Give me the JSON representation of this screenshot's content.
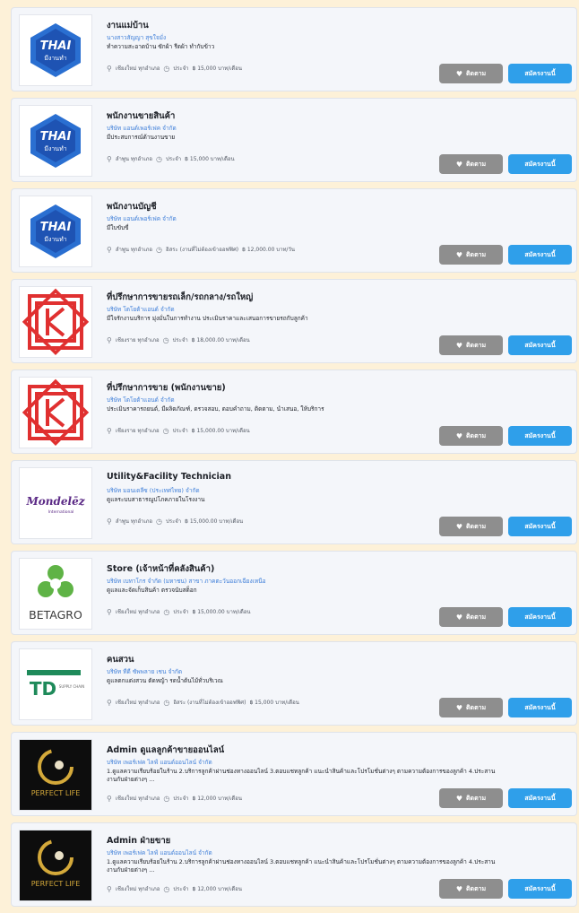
{
  "colors": {
    "apply": "#2f9fea",
    "save": "#8e8e8e",
    "company_link": "#3f7fd9",
    "background": "#fdf1d8"
  },
  "jobs": [
    {
      "logo": "thai-jobs-logo",
      "logo_text_1": "THAI",
      "logo_text_2": "มีงานทำ",
      "title": "งานแม่บ้าน",
      "company": "นางสาวสัญญา สุขใจมั่ง",
      "desc": "ทำความสะอาดบ้าน ซักผ้า รีดผ้า ทำกับข้าว",
      "location": "เชียงใหม่ ทุกอำเภอ",
      "type": "ประจำ",
      "salary": "฿ 15,000 บาท/เดือน",
      "save": "ติดตาม",
      "apply": "สมัครงานนี้"
    },
    {
      "logo": "thai-jobs-logo",
      "logo_text_1": "THAI",
      "logo_text_2": "มีงานทำ",
      "title": "พนักงานขายสินค้า",
      "company": "บริษัท แอนด์เพอร์เฟค จำกัด",
      "desc": "มีประสบการณ์ด้านงานขาย",
      "location": "ลำพูน ทุกอำเภอ",
      "type": "ประจำ",
      "salary": "฿ 15,000 บาท/เดือน",
      "save": "ติดตาม",
      "apply": "สมัครงานนี้"
    },
    {
      "logo": "thai-jobs-logo",
      "logo_text_1": "THAI",
      "logo_text_2": "มีงานทำ",
      "title": "พนักงานบัญชี",
      "company": "บริษัท แอนด์เพอร์เฟค จำกัด",
      "desc": "มีใบขับขี่",
      "location": "ลำพูน ทุกอำเภอ",
      "type": "อิสระ (งานที่ไม่ต้องเข้าออฟฟิศ)",
      "salary": "฿ 12,000.00 บาท/วัน",
      "save": "ติดตาม",
      "apply": "สมัครงานนี้"
    },
    {
      "logo": "red-k-logo",
      "title": "ที่ปรึกษาการขายรถเล็ก/รถกลาง/รถใหญ่",
      "company": "บริษัท โตโยต้าแอนด์ จำกัด",
      "desc": "มีใจรักงานบริการ มุ่งมั่นในการทำงาน ประเมินราคาและเสนอการขายรถกับลูกค้า",
      "location": "เชียงราย ทุกอำเภอ",
      "type": "ประจำ",
      "salary": "฿ 18,000.00 บาท/เดือน",
      "save": "ติดตาม",
      "apply": "สมัครงานนี้"
    },
    {
      "logo": "red-k-logo",
      "title": "ที่ปรึกษาการขาย (พนักงานขาย)",
      "company": "บริษัท โตโยต้าแอนด์ จำกัด",
      "desc": "ประเมินราคารถยนต์, มีผลิตภัณฑ์, ตรวจสอบ, ตอบคำถาม, ติดตาม, นำเสนอ, ให้บริการ",
      "location": "เชียงราย ทุกอำเภอ",
      "type": "ประจำ",
      "salary": "฿ 15,000.00 บาท/เดือน",
      "save": "ติดตาม",
      "apply": "สมัครงานนี้"
    },
    {
      "logo": "mondelez-logo",
      "logo_text_1": "Mondelēz",
      "logo_text_2": "International",
      "title": "Utility&Facility Technician",
      "company": "บริษัท มอนเดลีซ (ประเทศไทย) จำกัด",
      "desc": "ดูแลระบบสาธารณูปโภคภายในโรงงาน",
      "location": "ลำพูน ทุกอำเภอ",
      "type": "ประจำ",
      "salary": "฿ 15,000.00 บาท/เดือน",
      "save": "ติดตาม",
      "apply": "สมัครงานนี้"
    },
    {
      "logo": "betagro-logo",
      "logo_text_1": "BETAGRO",
      "title": "Store (เจ้าหน้าที่คลังสินค้า)",
      "company": "บริษัท เบทาโกร จำกัด (มหาชน) สาขา ภาคตะวันออกเฉียงเหนือ",
      "desc": "ดูแลและจัดเก็บสินค้า ตรวจนับสต็อก",
      "location": "เชียงใหม่ ทุกอำเภอ",
      "type": "ประจำ",
      "salary": "฿ 15,000.00 บาท/เดือน",
      "save": "ติดตาม",
      "apply": "สมัครงานนี้"
    },
    {
      "logo": "td-logo",
      "logo_text_1": "TD",
      "logo_text_2": "SUPPLY CHAIN",
      "title": "คนสวน",
      "company": "บริษัท ทีดี ซัพพลาย เชน จำกัด",
      "desc": "ดูแลตกแต่งสวน ตัดหญ้า รดน้ำต้นไม้ทั่วบริเวณ",
      "location": "เชียงใหม่ ทุกอำเภอ",
      "type": "อิสระ (งานที่ไม่ต้องเข้าออฟฟิศ)",
      "salary": "฿ 15,000 บาท/เดือน",
      "save": "ติดตาม",
      "apply": "สมัครงานนี้"
    },
    {
      "logo": "perfect-life-logo",
      "logo_text_1": "PERFECT LIFE",
      "title": "Admin ดูแลลูกค้าขายออนไลน์",
      "company": "บริษัท เพอร์เฟค ไลฟ์ แอนด์ออนไลน์ จำกัด",
      "desc": "1.ดูแลความเรียบร้อยในร้าน 2.บริการลูกค้าผ่านช่องทางออนไลน์ 3.ตอบแชทลูกค้า แนะนำสินค้าและโปรโมชั่นต่างๆ ตามความต้องการของลูกค้า 4.ประสานงานกับฝ่ายต่างๆ ...",
      "location": "เชียงใหม่ ทุกอำเภอ",
      "type": "ประจำ",
      "salary": "฿ 12,000 บาท/เดือน",
      "save": "ติดตาม",
      "apply": "สมัครงานนี้"
    },
    {
      "logo": "perfect-life-logo",
      "logo_text_1": "PERFECT LIFE",
      "title": "Admin ฝ่ายขาย",
      "company": "บริษัท เพอร์เฟค ไลฟ์ แอนด์ออนไลน์ จำกัด",
      "desc": "1.ดูแลความเรียบร้อยในร้าน 2.บริการลูกค้าผ่านช่องทางออนไลน์ 3.ตอบแชทลูกค้า แนะนำสินค้าและโปรโมชั่นต่างๆ ตามความต้องการของลูกค้า 4.ประสานงานกับฝ่ายต่างๆ ...",
      "location": "เชียงใหม่ ทุกอำเภอ",
      "type": "ประจำ",
      "salary": "฿ 12,000 บาท/เดือน",
      "save": "ติดตาม",
      "apply": "สมัครงานนี้"
    }
  ]
}
